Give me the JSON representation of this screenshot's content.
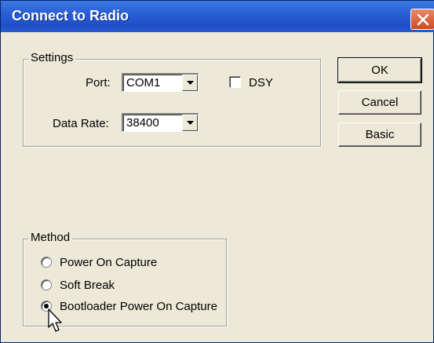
{
  "window": {
    "title": "Connect to Radio"
  },
  "settings": {
    "group_label": "Settings",
    "port_label": "Port:",
    "port_value": "COM1",
    "data_rate_label": "Data Rate:",
    "data_rate_value": "38400",
    "dsy_label": "DSY",
    "dsy_checked": false
  },
  "buttons": {
    "ok": "OK",
    "cancel": "Cancel",
    "basic": "Basic"
  },
  "method": {
    "group_label": "Method",
    "options": [
      {
        "label": "Power On Capture",
        "selected": false
      },
      {
        "label": "Soft Break",
        "selected": false
      },
      {
        "label": "Bootloader Power On Capture",
        "selected": true
      }
    ]
  },
  "icons": [
    "close-icon",
    "dropdown-arrow-icon",
    "mouse-cursor-icon"
  ]
}
